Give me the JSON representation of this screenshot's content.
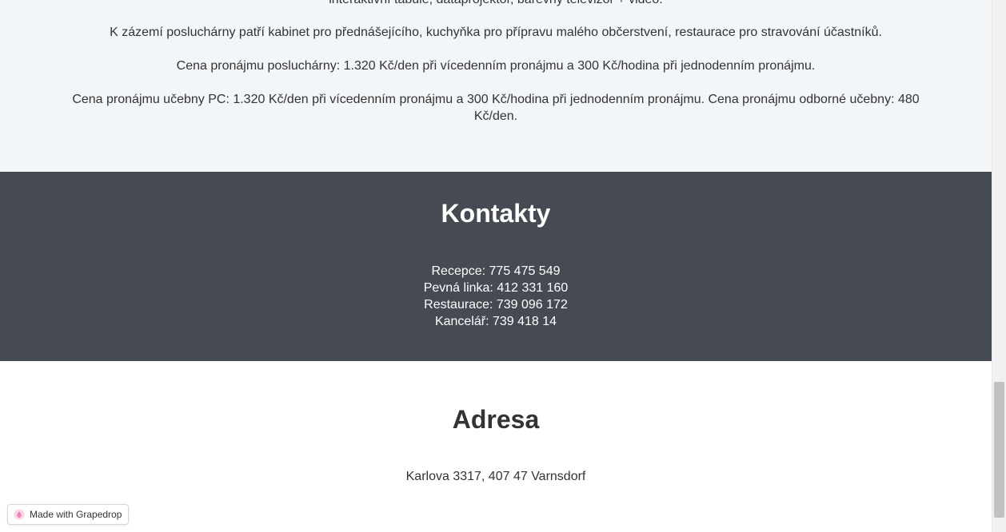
{
  "info": {
    "paragraphs": [
      "interaktivní tabule, dataprojektor, barevný televizor + video.",
      "K zázemí posluchárny patří kabinet pro přednášejícího, kuchyňka pro přípravu malého občerstvení, restaurace pro stravování účastníků.",
      "Cena pronájmu posluchárny: 1.320 Kč/den při vícedenním pronájmu a 300 Kč/hodina při jednodenním pronájmu.",
      "Cena pronájmu učebny PC: 1.320 Kč/den při vícedenním pronájmu a 300 Kč/hodina při jednodenním pronájmu. Cena pronájmu odborné učebny: 480 Kč/den."
    ]
  },
  "contacts": {
    "title": "Kontakty",
    "lines": [
      "Recepce: 775 475 549",
      "Pevná linka: 412 331 160",
      "Restaurace: 739 096 172",
      "Kancelář: 739 418 14"
    ]
  },
  "address": {
    "title": "Adresa",
    "text": "Karlova 3317, 407 47 Varnsdorf"
  },
  "badge": {
    "label": "Made with Grapedrop",
    "icon": "grapedrop-drop-icon"
  },
  "colors": {
    "info_bg": "#f3f6f9",
    "contacts_bg": "#464a53",
    "text": "#333333",
    "drop_icon": "#e888b4"
  }
}
